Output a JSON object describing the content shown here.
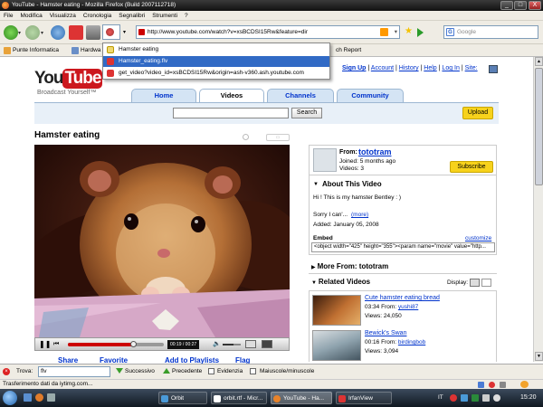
{
  "window": {
    "title": "YouTube - Hamster eating - Mozilla Firefox (Build 2007112718)",
    "controls": [
      "_",
      "□",
      "X"
    ]
  },
  "menu": [
    "File",
    "Modifica",
    "Visualizza",
    "Cronologia",
    "Segnalibri",
    "Strumenti",
    "?"
  ],
  "nav": {
    "url": "http://www.youtube.com/watch?v=xsBCDSI15Rw&feature=dir",
    "search_placeholder": "Google"
  },
  "bookmarks": {
    "items": [
      "Punte Informatica",
      "Hardwa"
    ],
    "right_item": "ch Report"
  },
  "dropdown": [
    "Hamster eating",
    "Hamster_eating.flv",
    "get_video?video_id=xsBCDSI15Rw&origin=ash-v360.ash.youtube.com"
  ],
  "youtube": {
    "logo_you": "You",
    "logo_tube": "Tube",
    "tagline": "Broadcast Yourself™",
    "top_links": [
      "Sign Up",
      "Account",
      "History",
      "Help",
      "Log In",
      "Site:"
    ],
    "tabs": [
      "Home",
      "Videos",
      "Channels",
      "Community"
    ],
    "search_button": "Search",
    "upload_button": "Upload",
    "video_title": "Hamster eating",
    "player": {
      "time": "00:19 / 00:27",
      "progress_fraction": 0.68,
      "volume_fraction": 0.6
    },
    "below_player": [
      "Share",
      "Favorite",
      "Add to Playlists",
      "Flag"
    ],
    "user": {
      "from_label": "From:",
      "name": "tototram",
      "joined": "Joined: 5 months ago",
      "videos": "Videos: 3",
      "subscribe": "Subscribe"
    },
    "about": {
      "heading": "About This Video",
      "line1": "Hi ! This is my hamster Bentley : )",
      "line2": "Sorry I can'...",
      "more": "(more)",
      "added": "Added: January 05, 2008",
      "embed_label": "Embed",
      "customize": "customize",
      "embed_code": "<object width=\"425\" height=\"355\"><param name=\"movie\" value=\"http..."
    },
    "more_from": "More From: tototram",
    "related": {
      "heading": "Related Videos",
      "display_label": "Display:",
      "items": [
        {
          "title": "Cute hamster eating bread",
          "time": "03:34",
          "from_label": "From:",
          "user": "yushi87",
          "views": "Views: 24,050"
        },
        {
          "title": "Bewick's Swan",
          "time": "00:16",
          "from_label": "From:",
          "user": "birdingbob",
          "views": "Views: 3,094"
        }
      ]
    }
  },
  "findbar": {
    "label": "Trova:",
    "value": "flv",
    "next": "Successivo",
    "prev": "Precedente",
    "highlight": "Evidenzia",
    "match_case": "Maiuscole/minuscole"
  },
  "status": "Trasferimento dati da iytimg.com...",
  "taskbar": {
    "items": [
      "Orbit Downloa...",
      "orbit.rtf - Micr...",
      "YouTube - Ha...",
      "IrfanView"
    ],
    "lang": "IT",
    "clock": "15:20"
  },
  "colors": {
    "youtube_red": "#cc181e",
    "link_blue": "#0033cc",
    "tab_blue": "#d4e4f4",
    "upload_yellow": "#f7d21c",
    "progress_red": "#cc0000"
  }
}
